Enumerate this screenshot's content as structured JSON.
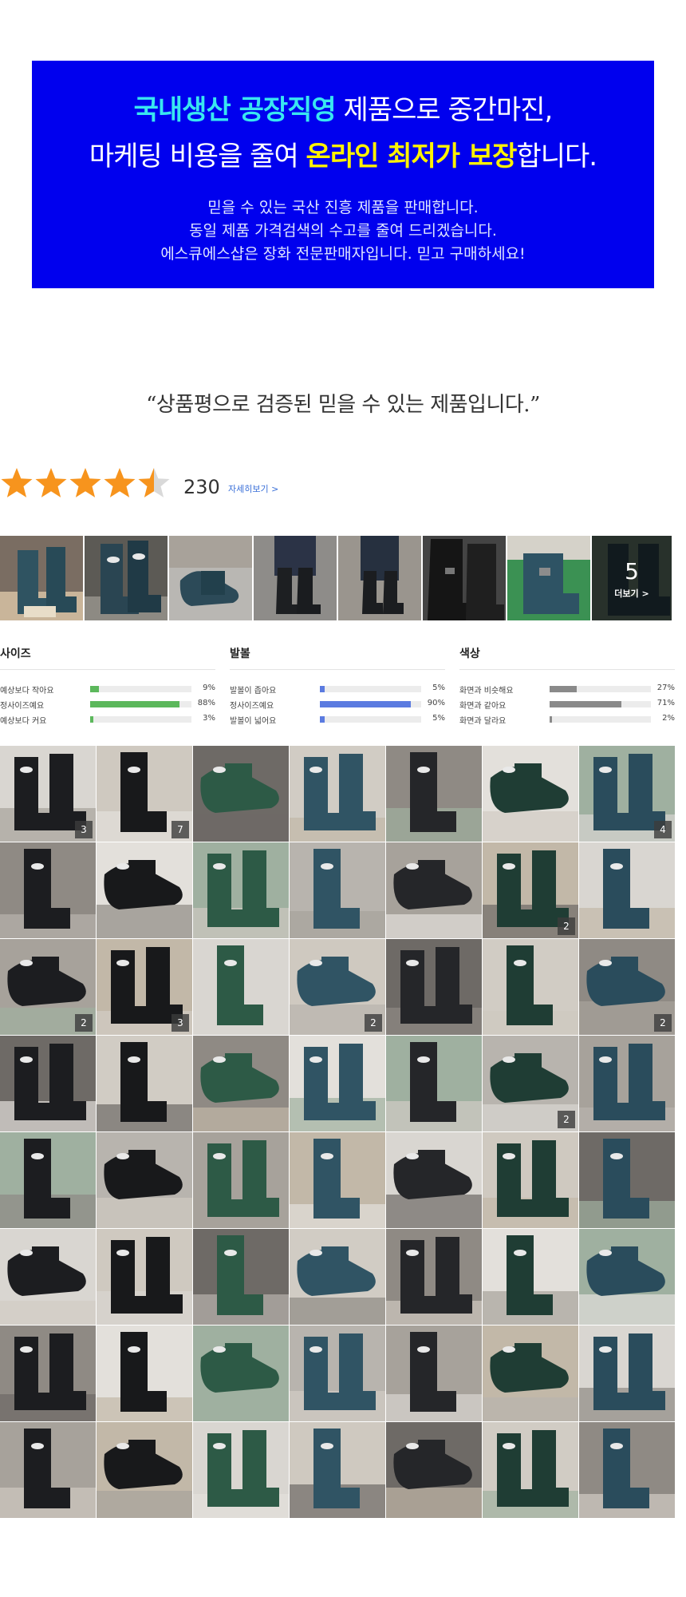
{
  "banner": {
    "line1_highlight": "국내생산 공장직영",
    "line1_rest": " 제품으로 중간마진,",
    "line2_start": "마케팅 비용을 줄여 ",
    "line2_highlight": "온라인 최저가 보장",
    "line2_end": "합니다.",
    "sub_lines": [
      "믿을 수 있는 국산 진흥 제품을 판매합니다.",
      "동일 제품 가격검색의 수고를 줄여 드리겠습니다.",
      "에스큐에스샵은 장화 전문판매자입니다. 믿고 구매하세요!"
    ]
  },
  "quote": "“상품평으로 검증된  믿을 수 있는 제품입니다.”",
  "rating": {
    "score": 4.5,
    "count": "230",
    "more_label": "자세히보기 >",
    "star_color": "#f7941d"
  },
  "photo_strip": {
    "more_count": "5",
    "more_label": "더보기 >"
  },
  "stats": [
    {
      "title": "사이즈",
      "color": "#5cb85c",
      "rows": [
        {
          "label": "예상보다 작아요",
          "pct": "9%",
          "value": 9
        },
        {
          "label": "정사이즈예요",
          "pct": "88%",
          "value": 88
        },
        {
          "label": "예상보다 커요",
          "pct": "3%",
          "value": 3
        }
      ]
    },
    {
      "title": "발볼",
      "color": "#5b7be0",
      "rows": [
        {
          "label": "발볼이 좁아요",
          "pct": "5%",
          "value": 5
        },
        {
          "label": "정사이즈예요",
          "pct": "90%",
          "value": 90
        },
        {
          "label": "발볼이 넓어요",
          "pct": "5%",
          "value": 5
        }
      ]
    },
    {
      "title": "색상",
      "color": "#8a8a8a",
      "rows": [
        {
          "label": "화면과 비슷해요",
          "pct": "27%",
          "value": 27
        },
        {
          "label": "화면과 같아요",
          "pct": "71%",
          "value": 71
        },
        {
          "label": "화면과 달라요",
          "pct": "2%",
          "value": 2
        }
      ]
    }
  ],
  "grid_badges": [
    "3",
    "7",
    "",
    "",
    "",
    "",
    "4",
    "",
    "",
    "",
    "",
    "",
    "2",
    "",
    "2",
    "3",
    "",
    "2",
    "",
    "",
    "2",
    "",
    "",
    "",
    "",
    "",
    "2",
    "",
    "",
    "",
    "",
    "",
    "",
    "",
    "",
    "",
    "",
    "",
    "",
    "",
    "",
    "",
    "",
    "",
    "",
    "",
    "",
    "",
    "",
    "",
    "",
    "",
    "",
    "",
    "",
    ""
  ]
}
